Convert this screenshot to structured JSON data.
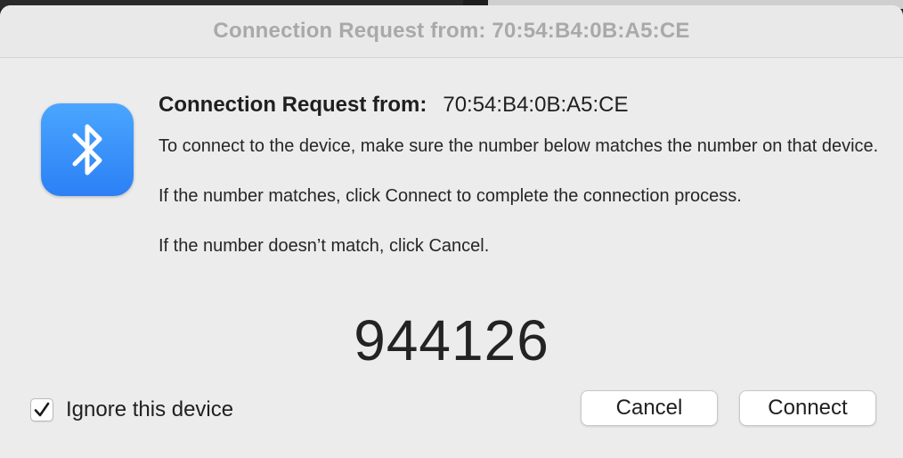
{
  "window": {
    "title": "Connection Request from: 70:54:B4:0B:A5:CE"
  },
  "icon": {
    "name": "bluetooth-icon",
    "background": "#3a8ff8"
  },
  "message": {
    "heading_label": "Connection Request from:",
    "heading_value": "70:54:B4:0B:A5:CE",
    "paragraph_1": "To connect to the device, make sure the number below matches the number on that device.",
    "paragraph_2": "If the number matches, click Connect to complete the connection process.",
    "paragraph_3": "If the number doesn’t match, click Cancel."
  },
  "passkey": "944126",
  "options": {
    "ignore_label": "Ignore this device",
    "ignore_checked": true
  },
  "buttons": {
    "cancel": "Cancel",
    "connect": "Connect"
  }
}
